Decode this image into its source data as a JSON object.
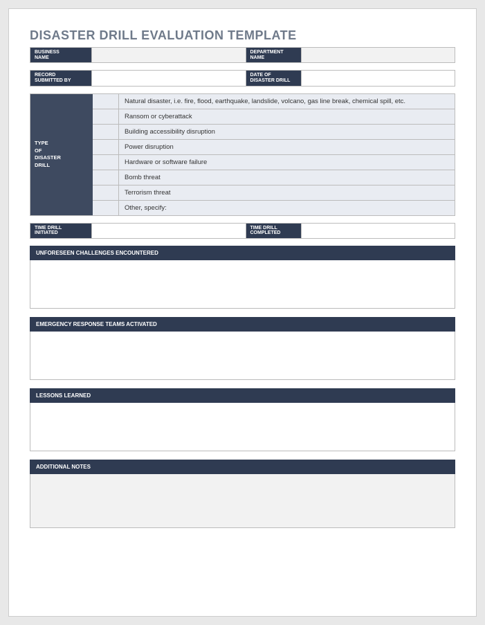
{
  "title": "DISASTER DRILL EVALUATION TEMPLATE",
  "fields": {
    "business_name_label": "BUSINESS\nNAME",
    "department_name_label": "DEPARTMENT\nNAME",
    "record_submitted_label": "RECORD\nSUBMITTED BY",
    "date_of_drill_label": "DATE OF\nDISASTER DRILL",
    "time_initiated_label": "TIME DRILL\nINITIATED",
    "time_completed_label": "TIME DRILL\nCOMPLETED"
  },
  "type_block": {
    "label": "TYPE\nOF\nDISASTER\nDRILL",
    "options": [
      "Natural disaster, i.e. fire, flood, earthquake, landslide, volcano, gas line break, chemical spill, etc.",
      "Ransom or cyberattack",
      "Building accessibility disruption",
      "Power disruption",
      "Hardware or software failure",
      "Bomb threat",
      "Terrorism threat",
      "Other, specify:"
    ]
  },
  "sections": {
    "unforeseen": "UNFORESEEN CHALLENGES ENCOUNTERED",
    "response_teams": "EMERGENCY RESPONSE TEAMS ACTIVATED",
    "lessons": "LESSONS LEARNED",
    "notes": "ADDITIONAL NOTES"
  }
}
